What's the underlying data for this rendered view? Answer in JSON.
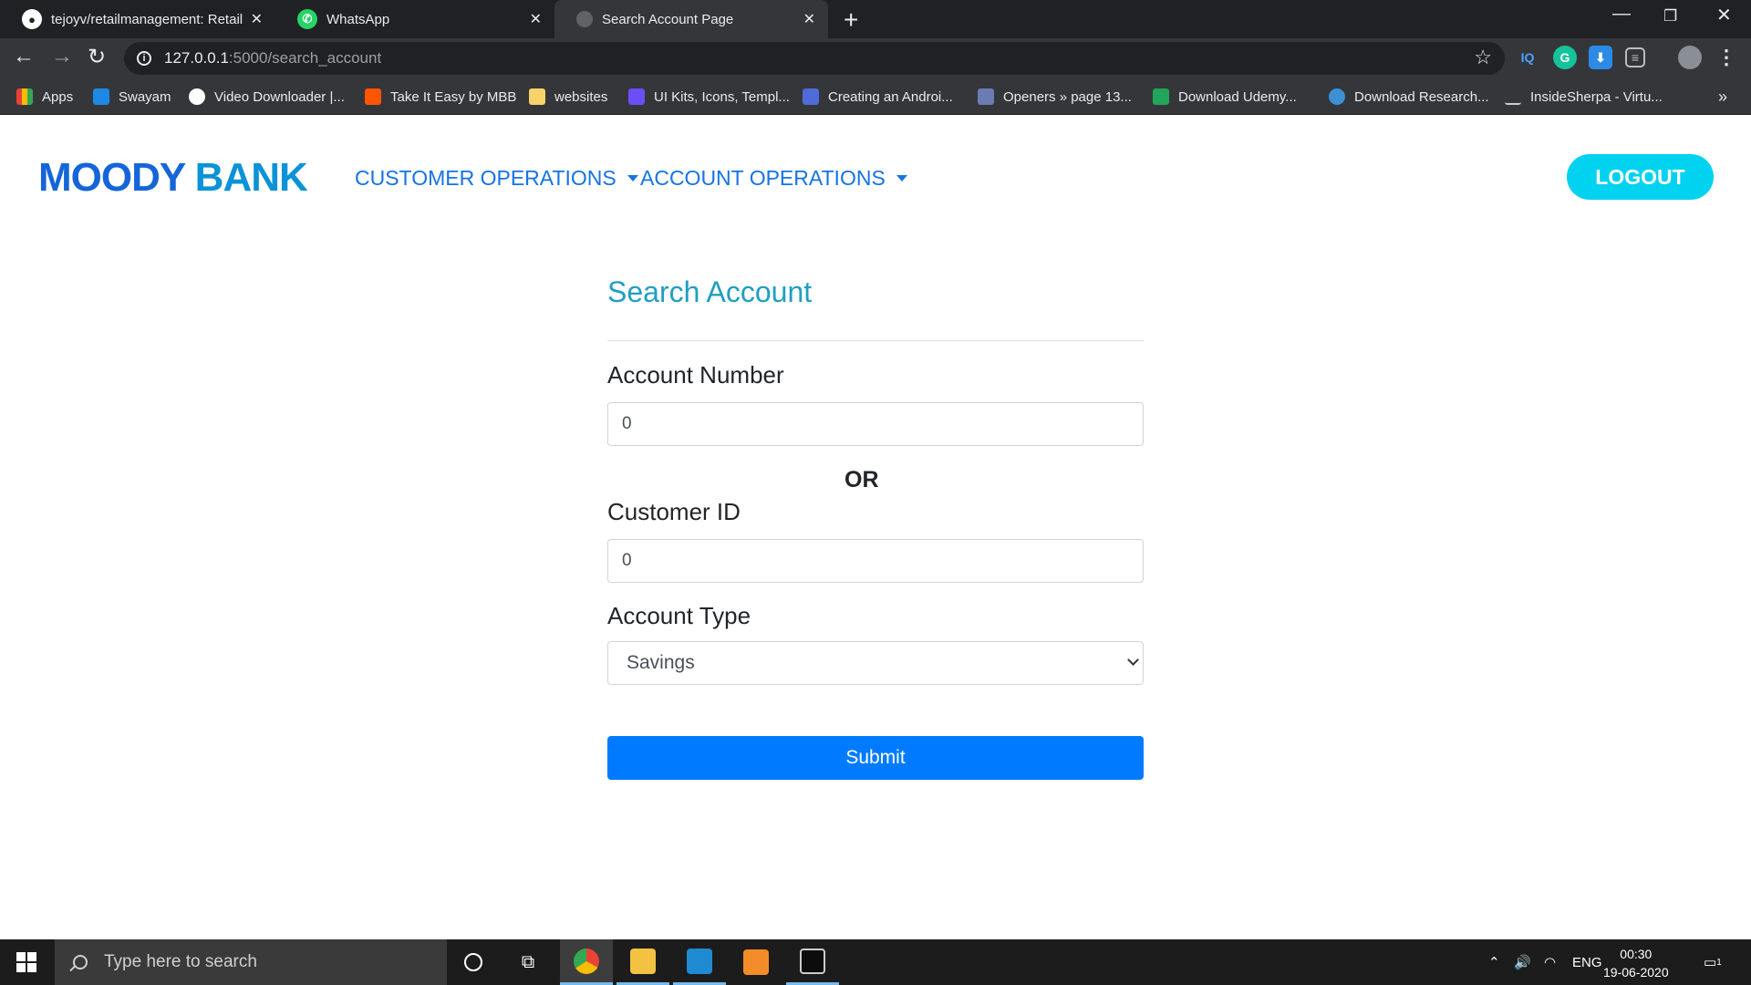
{
  "browser": {
    "tabs": [
      {
        "title": "tejoyv/retailmanagement: Retail M",
        "icon": "github-icon"
      },
      {
        "title": "WhatsApp",
        "icon": "whatsapp-icon"
      },
      {
        "title": "Search Account Page",
        "icon": "globe-icon"
      }
    ],
    "url_host": "127.0.0.1",
    "url_path": ":5000/search_account",
    "bookmarks": [
      {
        "label": "Apps",
        "color": "#e94235"
      },
      {
        "label": "Swayam",
        "color": "#1e88e5"
      },
      {
        "label": "Video Downloader |...",
        "color": "#ffffff"
      },
      {
        "label": "Take It Easy by MBB",
        "color": "#ff5500"
      },
      {
        "label": "websites",
        "color": "#f6d36b"
      },
      {
        "label": "UI Kits, Icons, Templ...",
        "color": "#6b4ef6"
      },
      {
        "label": "Creating an Androi...",
        "color": "#4f6bd9"
      },
      {
        "label": "Openers » page 13...",
        "color": "#6b7bb3"
      },
      {
        "label": "Download Udemy...",
        "color": "#22a55a"
      },
      {
        "label": "Download Research...",
        "color": "#3d8fd6"
      },
      {
        "label": "InsideSherpa - Virtu...",
        "color": "#cccccc"
      }
    ]
  },
  "navbar": {
    "brand_part1": "MOODY",
    "brand_part2": "BANK",
    "links": [
      {
        "label": "CUSTOMER OPERATIONS"
      },
      {
        "label": "ACCOUNT OPERATIONS"
      }
    ],
    "logout_label": "LOGOUT"
  },
  "form": {
    "title": "Search Account",
    "account_number_label": "Account Number",
    "account_number_value": "0",
    "or_label": "OR",
    "customer_id_label": "Customer ID",
    "customer_id_value": "0",
    "account_type_label": "Account Type",
    "account_type_selected": "Savings",
    "submit_label": "Submit"
  },
  "taskbar": {
    "search_placeholder": "Type here to search",
    "language": "ENG",
    "time": "00:30",
    "date": "19-06-2020",
    "notification_count": "1"
  }
}
